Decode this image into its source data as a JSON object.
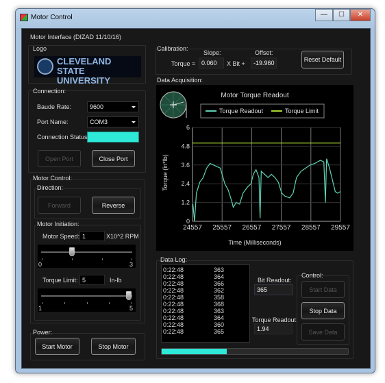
{
  "window": {
    "title": "Motor Control",
    "minimize": "—",
    "maximize": "☐",
    "close": "✕"
  },
  "main_group": "Motor Interface (DIZAD 11/10/16)",
  "logo": {
    "label": "Logo",
    "line1": "CLEVELAND STATE",
    "line2": "UNIVERSITY"
  },
  "connection": {
    "label": "Connection:",
    "baud_label": "Baude Rate:",
    "baud_value": "9600",
    "port_label": "Port Name:",
    "port_value": "COM3",
    "status_label": "Connection Status:",
    "status_color": "#2ee8d8",
    "open_port": "Open Port",
    "close_port": "Close Port"
  },
  "motor_control": {
    "label": "Motor Control:",
    "direction_label": "Direction:",
    "forward": "Forward",
    "reverse": "Reverse",
    "initiation_label": "Motor Initiation:",
    "speed_label": "Motor Speed:",
    "speed_value": "1",
    "speed_unit": "X10^2 RPM",
    "speed_min": "0",
    "speed_max": "3",
    "speed_slider_value": 1,
    "torque_label": "Torque Limit:",
    "torque_value": "5",
    "torque_unit": "In-lb",
    "torque_min": "1",
    "torque_max": "5",
    "torque_slider_value": 5
  },
  "power": {
    "label": "Power:",
    "start": "Start Motor",
    "stop": "Stop Motor"
  },
  "calibration": {
    "label": "Calibration:",
    "slope_label": "Slope:",
    "offset_label": "Offset:",
    "torque_eq": "Torque =",
    "slope_value": "0.060",
    "xbit": "X Bit  +",
    "offset_value": "-19.960",
    "reset": "Reset Default"
  },
  "acquisition": {
    "label": "Data Acquisition:"
  },
  "chart_data": {
    "type": "line",
    "title": "Motor Torque Readout",
    "xlabel": "Time (Milliseconds)",
    "ylabel": "Torque (in*lb)",
    "xlim": [
      24557,
      29557
    ],
    "ylim": [
      0,
      6
    ],
    "xticks": [
      "24557",
      "25557",
      "26557",
      "27557",
      "28557",
      "29557"
    ],
    "yticks": [
      "0",
      "1.2",
      "2.4",
      "3.6",
      "4.8",
      "6"
    ],
    "grid": true,
    "legend": "top-center",
    "series": [
      {
        "name": "Torque Readout",
        "color": "#5fd3b4",
        "x": [
          24570,
          24626,
          24688,
          24803,
          24918,
          25034,
          25150,
          25265,
          25380,
          25495,
          25572,
          25649,
          25764,
          25880,
          25934,
          26034,
          26149,
          26264,
          26418,
          26534,
          26611,
          26703,
          26803,
          26841,
          26880,
          26995,
          27110,
          27226,
          27341,
          27457,
          27572,
          27688,
          27841,
          27957,
          28072,
          28226,
          28380,
          28534,
          28688,
          28880,
          28995,
          29049,
          29088,
          29188,
          29303,
          29380,
          29457,
          29557
        ],
        "y": [
          1.1,
          0,
          1.8,
          2.5,
          2.8,
          3.4,
          3.7,
          3.6,
          3.5,
          3.4,
          2.9,
          2.4,
          2.0,
          1.3,
          0.9,
          1.2,
          1.1,
          1.8,
          2.2,
          2.4,
          3.0,
          3.3,
          2.8,
          0.2,
          3.2,
          3.0,
          2.8,
          3.0,
          2.8,
          2.5,
          1.8,
          1.6,
          1.5,
          1.8,
          2.8,
          3.2,
          3.4,
          3.6,
          3.7,
          3.9,
          3.8,
          1.2,
          4.0,
          3.4,
          2.5,
          1.9,
          1.8,
          1.9
        ]
      },
      {
        "name": "Torque Limit",
        "color": "#a8d832",
        "x": [
          24557,
          29557
        ],
        "y": [
          5,
          5
        ]
      }
    ]
  },
  "data_log": {
    "label": "Data Log:",
    "rows": [
      [
        "0:22:48",
        "363"
      ],
      [
        "0:22:48",
        "364"
      ],
      [
        "0:22:48",
        "366"
      ],
      [
        "0:22:48",
        "362"
      ],
      [
        "0:22:48",
        "358"
      ],
      [
        "0:22:48",
        "368"
      ],
      [
        "0:22:48",
        "363"
      ],
      [
        "0:22:48",
        "364"
      ],
      [
        "0:22:48",
        "360"
      ],
      [
        "0:22:48",
        "365"
      ]
    ]
  },
  "readouts": {
    "bit_label": "Bit Readout:",
    "bit_value": "365",
    "torque_label": "Torque Readout:",
    "torque_value": "1.94"
  },
  "control": {
    "label": "Control:",
    "start": "Start Data",
    "stop": "Stop Data",
    "save": "Save Data"
  },
  "progress": {
    "value_percent": 35,
    "color": "#2ee8d8"
  }
}
